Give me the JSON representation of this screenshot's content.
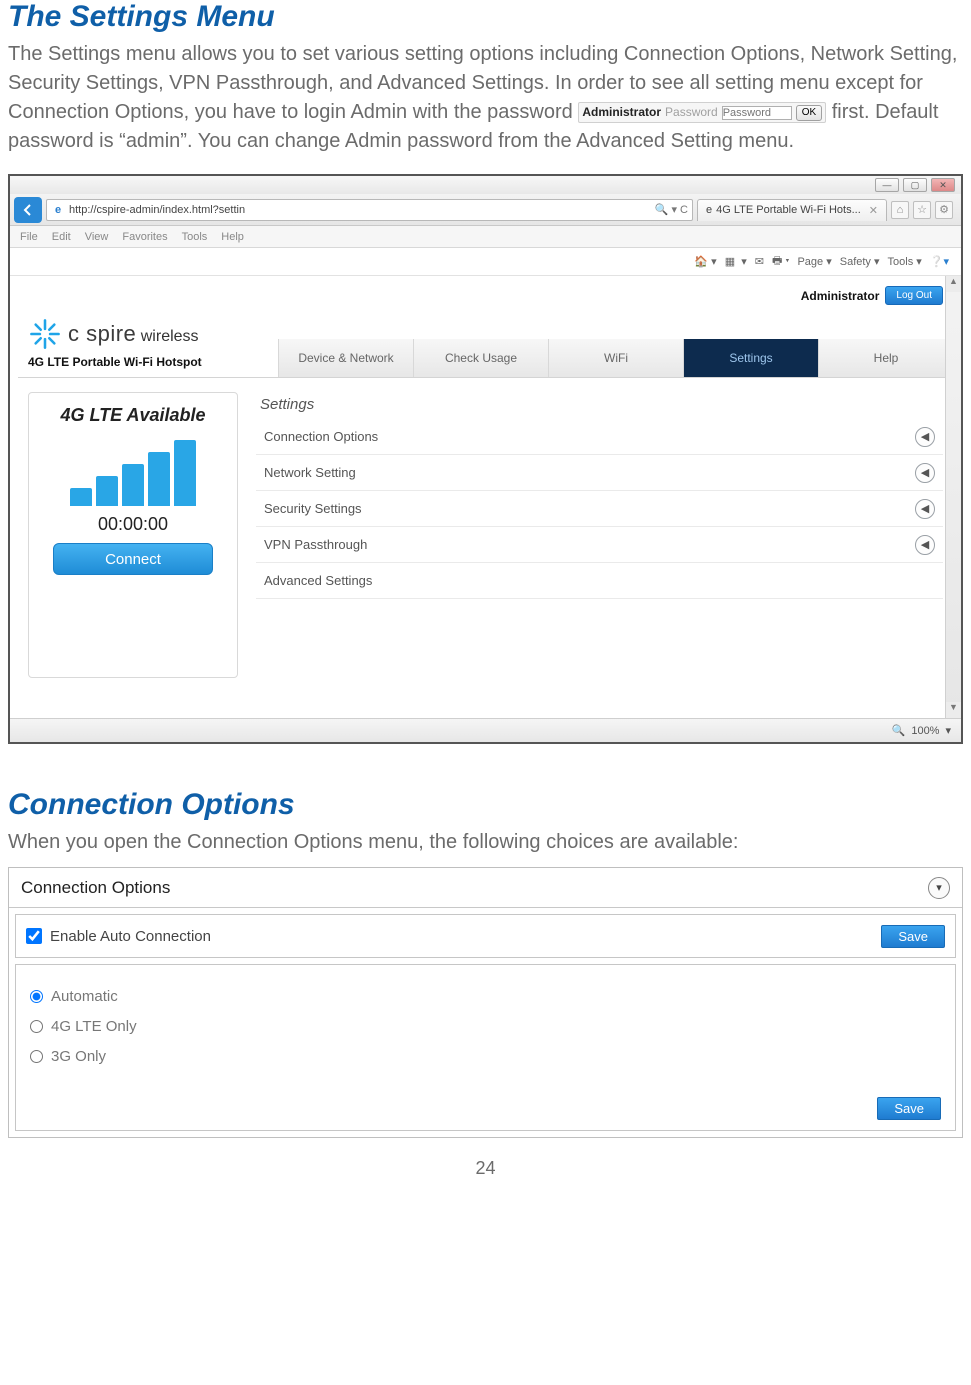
{
  "heading1": "The Settings Menu",
  "para1a": "The Settings menu allows you to set various setting options including Connection Options, Network Setting, Security Settings, VPN Passthrough, and Advanced Settings. In order to see all setting menu except for Connection Options, you have to login Admin with the password ",
  "para1b": "first.  Default password is “admin”.  You can change Admin password from the Advanced Setting menu.",
  "inline_widget": {
    "label": "Administrator",
    "placeholder": "Password",
    "ok": "OK"
  },
  "ie": {
    "url": "http://cspire-admin/index.html?settin",
    "search_suffix": " ▾ ×",
    "search_glyph": "🔍 ▾  C",
    "ie_glyph": "e",
    "tab_title": "4G LTE Portable Wi-Fi Hots...",
    "menu": [
      "File",
      "Edit",
      "View",
      "Favorites",
      "Tools",
      "Help"
    ],
    "cmdrow": {
      "page": "Page ▾",
      "safety": "Safety ▾",
      "tools": "Tools ▾"
    },
    "admin_label": "Administrator",
    "logout": "Log Out",
    "brand_main": "c spire",
    "brand_sub": "wireless",
    "product": "4G LTE Portable Wi-Fi Hotspot",
    "tabs": [
      "Device & Network",
      "Check Usage",
      "WiFi",
      "Settings",
      "Help"
    ],
    "status_title": "4G LTE Available",
    "timer": "00:00:00",
    "connect": "Connect",
    "panel_title": "Settings",
    "settings_items": [
      "Connection Options",
      "Network Setting",
      "Security Settings",
      "VPN Passthrough",
      "Advanced Settings"
    ],
    "zoom": "100%"
  },
  "heading2": "Connection Options",
  "para2": "When you open the Connection Options menu, the following choices are available:",
  "co": {
    "title": "Connection Options",
    "enable_label": "Enable Auto Connection",
    "save": "Save",
    "radios": [
      "Automatic",
      "4G LTE Only",
      "3G Only"
    ]
  },
  "page_number": "24"
}
